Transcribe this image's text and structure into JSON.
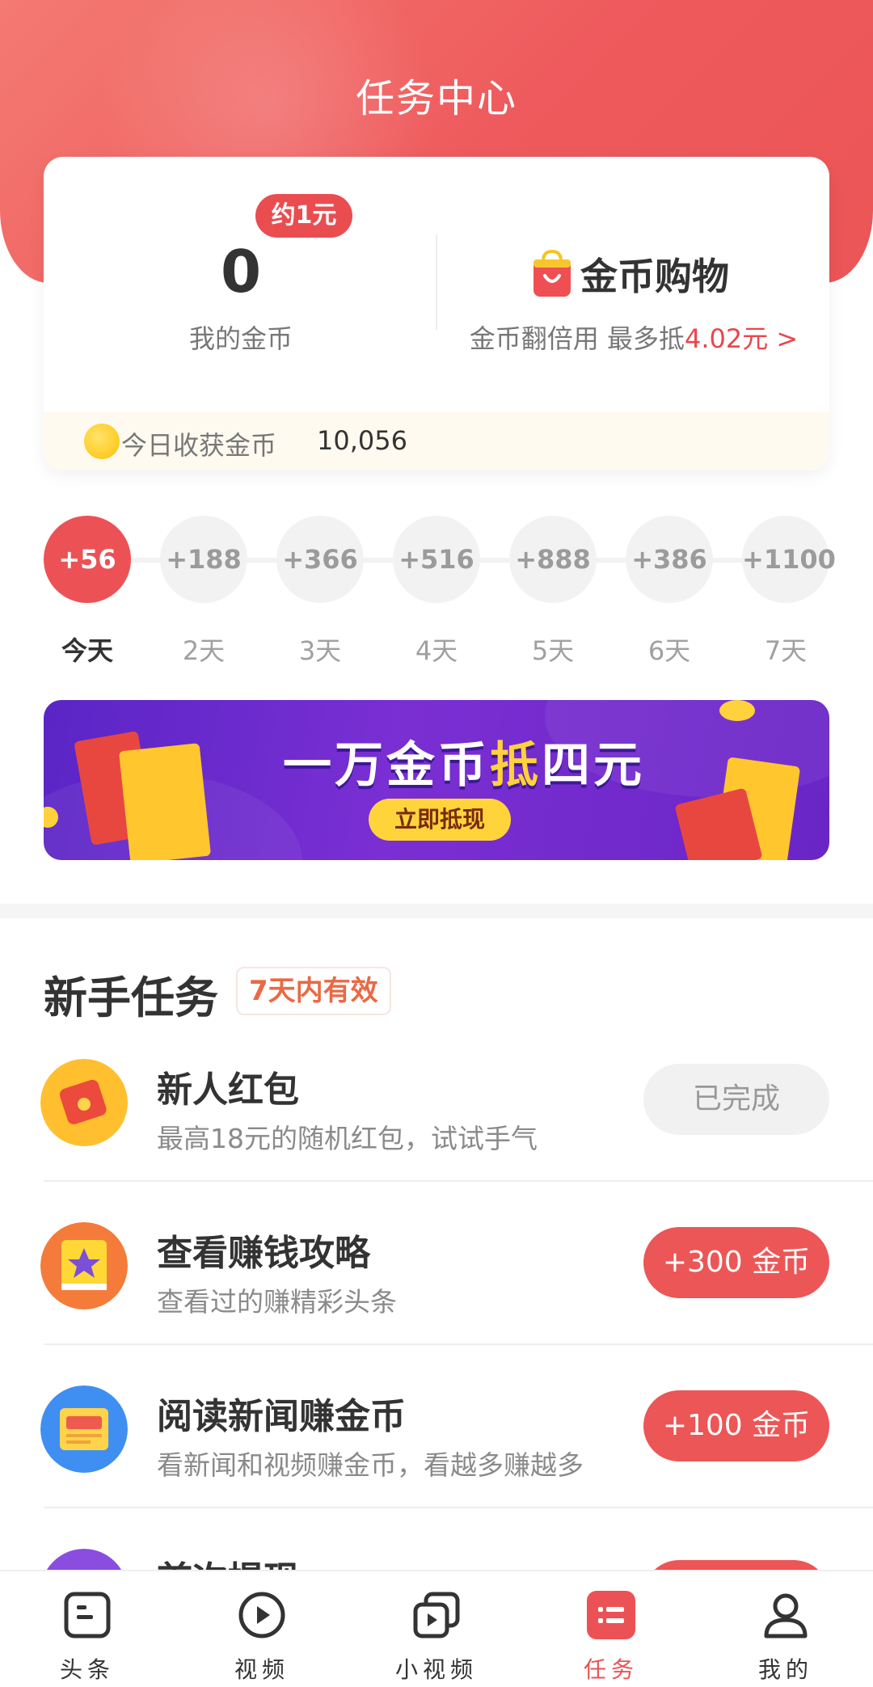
{
  "header": {
    "title": "任务中心"
  },
  "coins": {
    "badge": "约1元",
    "value": "0",
    "label": "我的金币",
    "shop_title": "金币购物",
    "shop_desc_prefix": "金币翻倍用 最多抵",
    "shop_desc_amount": "4.02元",
    "shop_desc_chevron": ">",
    "today_label": "今日收获金币",
    "today_value": "10,056"
  },
  "checkin": {
    "days": [
      {
        "reward": "+56",
        "label": "今天",
        "active": true
      },
      {
        "reward": "+188",
        "label": "2天",
        "active": false
      },
      {
        "reward": "+366",
        "label": "3天",
        "active": false
      },
      {
        "reward": "+516",
        "label": "4天",
        "active": false
      },
      {
        "reward": "+888",
        "label": "5天",
        "active": false
      },
      {
        "reward": "+386",
        "label": "6天",
        "active": false
      },
      {
        "reward": "+1100",
        "label": "7天",
        "active": false
      }
    ]
  },
  "banner": {
    "title_a": "一万金币",
    "title_hot": "抵",
    "title_b": "四元",
    "button": "立即抵现"
  },
  "newbie": {
    "title": "新手任务",
    "tag": "7天内有效",
    "tasks": [
      {
        "icon": "red-envelope-icon",
        "name": "新人红包",
        "desc": "最高18元的随机红包，试试手气",
        "button": "已完成",
        "done": true
      },
      {
        "icon": "star-book-icon",
        "name": "查看赚钱攻略",
        "desc": "查看过的赚精彩头条",
        "button": "+300 金币",
        "done": false
      },
      {
        "icon": "newspaper-icon",
        "name": "阅读新闻赚金币",
        "desc": "看新闻和视频赚金币，看越多赚越多",
        "button": "+100 金币",
        "done": false
      },
      {
        "icon": "withdraw-icon",
        "name": "首次提现",
        "desc": "",
        "button": "",
        "done": false
      }
    ]
  },
  "tabbar": {
    "items": [
      {
        "label": "头条",
        "icon": "headline-icon",
        "active": false
      },
      {
        "label": "视频",
        "icon": "play-icon",
        "active": false
      },
      {
        "label": "小视频",
        "icon": "short-video-icon",
        "active": false
      },
      {
        "label": "任务",
        "icon": "task-list-icon",
        "active": true
      },
      {
        "label": "我的",
        "icon": "profile-icon",
        "active": false
      }
    ]
  },
  "colors": {
    "accent": "#ec5255",
    "banner": "#6b28c8",
    "gold": "#ffd13a"
  }
}
